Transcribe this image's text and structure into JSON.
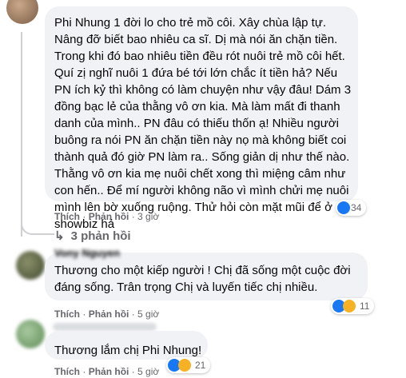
{
  "comments": [
    {
      "text": "Phi Nhung 1 đời lo cho trẻ mồ côi. Xây chùa lập tự. Nâng đỡ biết bao nhiêu ca sĩ. Dị mà nói ăn chặn tiền. Trong khi đó bao nhiêu tiền đều rót nuôi trẻ mồ côi hết. Quí zị nghĩ nuôi 1 đứa bé tới lớn chắc ít tiền hả? Nếu PN ích kỷ thì không có làm chuyện như vậy đâu! Dám 3 đồng bạc lẻ của thằng vô ơn kia. Mà làm mất đi thanh danh của mình.. PN đâu có thiếu thốn ạ! Nhiều người buông ra nói PN ăn chặn tiền này nọ mà không biết coi thành quả đó giờ PN làm ra.. Sống giản dị như thế nào. Thằng vô ơn kia mẹ nuôi chết xong thì miệng câm như con hến.. Để mí người không não vì mình chửi mẹ nuôi mình lên bờ xuống ruộng. Thử hỏi còn mặt mũi để ở showbiz hả",
      "like": "Thích",
      "reply": "Phản hồi",
      "time": "3 giờ",
      "reactions": "34"
    },
    {
      "author": "Vony Nguyen",
      "text": "Thương cho một kiếp người ! Chị đã sống một cuộc đời đáng sống. Trân trọng Chị và luyến tiếc chị nhiều.",
      "like": "Thích",
      "reply": "Phản hồi",
      "time": "5 giờ",
      "reactions": "11"
    },
    {
      "text": "Thương lắm chị Phi Nhung!",
      "like": "Thích",
      "reply": "Phản hồi",
      "time": "5 giờ",
      "reactions": "21"
    }
  ],
  "replies_link": "3 phản hồi",
  "separator": "·"
}
